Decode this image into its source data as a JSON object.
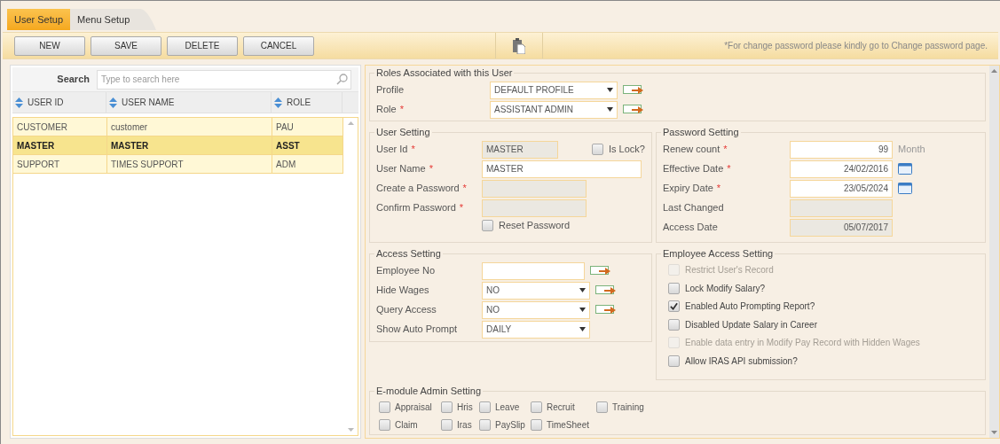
{
  "tabs": [
    {
      "label": "User Setup",
      "selected": true
    },
    {
      "label": "Menu Setup",
      "selected": false
    }
  ],
  "toolbar": {
    "buttons": [
      "NEW",
      "SAVE",
      "DELETE",
      "CANCEL"
    ],
    "notice": "*For change password please kindly go to Change password page."
  },
  "search": {
    "label": "Search",
    "placeholder": "Type to search here"
  },
  "table": {
    "columns": [
      "USER ID",
      "USER NAME",
      "ROLE"
    ],
    "rows": [
      {
        "cells": [
          "CUSTOMER",
          "customer",
          "PAU"
        ],
        "selected": false
      },
      {
        "cells": [
          "MASTER",
          "MASTER",
          "ASST"
        ],
        "selected": true
      },
      {
        "cells": [
          "SUPPORT",
          "TIMES SUPPORT",
          "ADM"
        ],
        "selected": false
      }
    ]
  },
  "roles": {
    "title": "Roles Associated with this User",
    "fields": [
      {
        "label": "Profile",
        "kind": "select",
        "value": "DEFAULT PROFILE",
        "lookup": true
      },
      {
        "label": "Role",
        "required_mark": "*",
        "kind": "select",
        "value": "ASSISTANT ADMIN",
        "lookup": true
      }
    ]
  },
  "user_setting": {
    "title": "User Setting",
    "fields": [
      {
        "label": "User Id",
        "required_mark": "*",
        "kind": "readonly",
        "value": "MASTER"
      },
      {
        "label": "User Name",
        "required_mark": "*",
        "kind": "text",
        "value": "MASTER"
      },
      {
        "label": "Create a Password",
        "required_mark": "*",
        "kind": "readonly"
      },
      {
        "label": "Confirm Password",
        "required_mark": "*",
        "kind": "readonly"
      }
    ],
    "lock": {
      "label": "Is Lock?",
      "checked": false
    },
    "reset": {
      "label": "Reset Password",
      "checked": false
    }
  },
  "password_setting": {
    "title": "Password Setting",
    "fields": [
      {
        "label": "Renew count",
        "required_mark": "*",
        "kind": "text",
        "value": "99",
        "unit": "Month"
      },
      {
        "label": "Effective Date",
        "required_mark": "*",
        "kind": "date",
        "value": "24/02/2016"
      },
      {
        "label": "Expiry Date",
        "required_mark": "*",
        "kind": "date",
        "value": "23/05/2024"
      },
      {
        "label": "Last Changed",
        "kind": "readonly"
      },
      {
        "label": "Access Date",
        "kind": "readonly",
        "value": "05/07/2017"
      }
    ]
  },
  "access_setting": {
    "title": "Access Setting",
    "fields": [
      {
        "label": "Employee No",
        "kind": "text",
        "lookup": true
      },
      {
        "label": "Hide Wages",
        "kind": "select",
        "value": "NO",
        "lookup": true
      },
      {
        "label": "Query Access",
        "kind": "select",
        "value": "NO",
        "lookup": true
      },
      {
        "label": "Show Auto Prompt",
        "kind": "select",
        "value": "DAILY",
        "lookup": false
      }
    ]
  },
  "employee_access": {
    "title": "Employee Access Setting",
    "options": [
      {
        "label": "Restrict User's Record",
        "checked": false,
        "disabled": true
      },
      {
        "label": "Lock Modify Salary?",
        "checked": false,
        "disabled": false
      },
      {
        "label": "Enabled Auto Prompting Report?",
        "checked": true,
        "disabled": false
      },
      {
        "label": "Disabled Update Salary in Career",
        "checked": false,
        "disabled": false
      },
      {
        "label": "Enable data entry in Modify Pay Record with Hidden Wages",
        "checked": false,
        "disabled": true
      },
      {
        "label": "Allow IRAS API submission?",
        "checked": false,
        "disabled": false
      }
    ]
  },
  "emodule": {
    "title": "E-module Admin Setting",
    "rows": [
      {
        "options": [
          {
            "label": "Appraisal",
            "checked": false
          },
          {
            "label": "Hris",
            "checked": false
          },
          {
            "label": "Leave",
            "checked": false
          },
          {
            "label": "Recruit",
            "checked": false
          },
          {
            "label": "Training",
            "checked": false
          }
        ]
      },
      {
        "options": [
          {
            "label": "Claim",
            "checked": false
          },
          {
            "label": "Iras",
            "checked": false
          },
          {
            "label": "PaySlip",
            "checked": false
          },
          {
            "label": "TimeSheet",
            "checked": false
          }
        ]
      }
    ]
  }
}
